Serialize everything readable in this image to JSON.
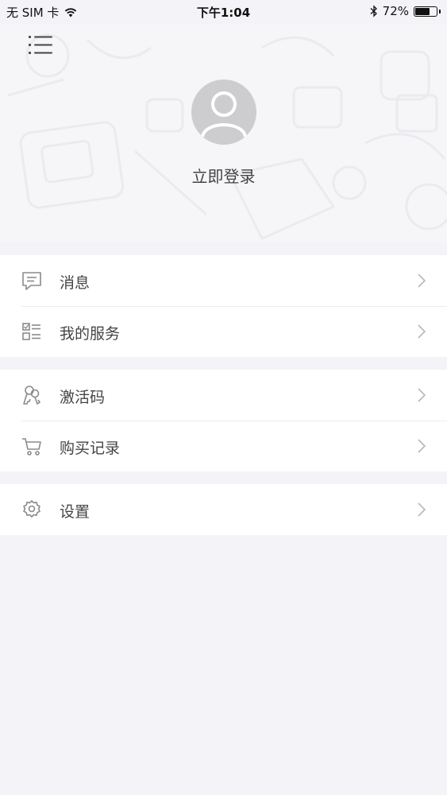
{
  "status_bar": {
    "carrier": "无 SIM 卡",
    "time": "下午1:04",
    "battery_percent": "72%",
    "battery_level": 0.72
  },
  "header": {
    "login_label": "立即登录"
  },
  "menu_groups": [
    {
      "items": [
        {
          "label": "消息",
          "icon": "message-icon"
        },
        {
          "label": "我的服务",
          "icon": "service-list-icon"
        }
      ]
    },
    {
      "items": [
        {
          "label": "激活码",
          "icon": "key-icon"
        },
        {
          "label": "购买记录",
          "icon": "cart-icon"
        }
      ]
    },
    {
      "items": [
        {
          "label": "设置",
          "icon": "gear-icon"
        }
      ]
    }
  ],
  "colors": {
    "background": "#f4f3f7",
    "row_background": "#ffffff",
    "text": "#444444",
    "icon": "#8a8a8e",
    "avatar": "#cdcdcf"
  }
}
